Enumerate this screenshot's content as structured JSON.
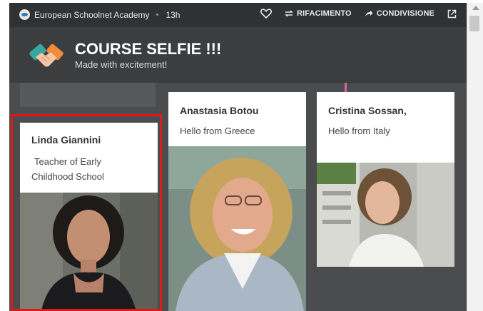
{
  "topbar": {
    "author": "European Schoolnet Academy",
    "time": "13h",
    "remake_label": "RIFACIMENTO",
    "share_label": "CONDIVISIONE"
  },
  "header": {
    "title": "COURSE SELFIE !!!",
    "subtitle": "Made with excitement!"
  },
  "posts": [
    {
      "name": "Linda Giannini",
      "message_line1": "Teacher of Early",
      "message_line2": "Childhood School"
    },
    {
      "name": "Anastasia Botou",
      "message": "Hello from Greece"
    },
    {
      "name": "Cristina Sossan,",
      "message": "Hello from Italy"
    }
  ],
  "colors": {
    "accent_highlight": "#e01818",
    "board_bg": "#4a4c4e",
    "header_bg": "#3b3d3f"
  }
}
